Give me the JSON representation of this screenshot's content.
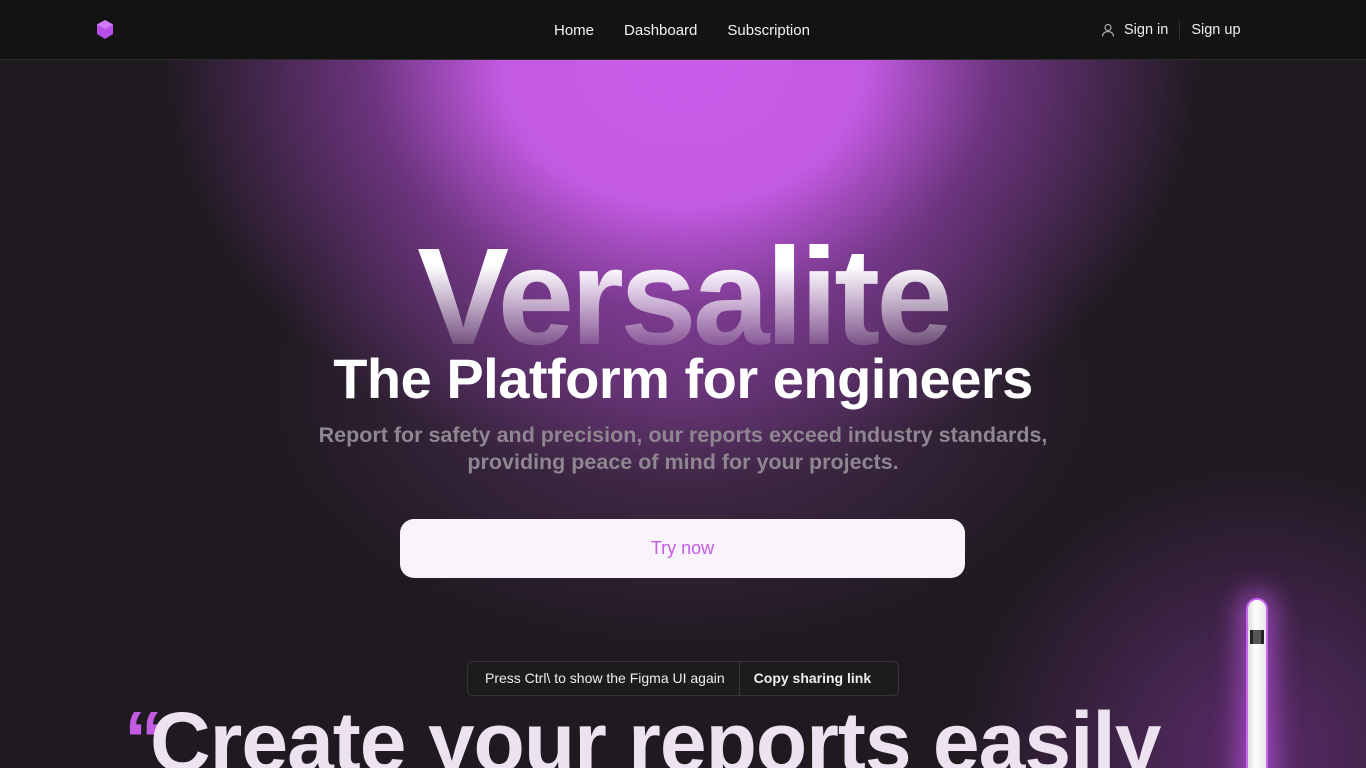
{
  "nav": {
    "links": [
      "Home",
      "Dashboard",
      "Subscription"
    ],
    "sign_in": "Sign in",
    "sign_up": "Sign up"
  },
  "hero": {
    "brand": "Versalite",
    "title": "The Platform for engineers",
    "subtitle_line1": "Report for safety and precision, our reports exceed industry standards,",
    "subtitle_line2": "providing peace of mind for your projects.",
    "cta": "Try now"
  },
  "section": {
    "quote_mark": "“",
    "heading": "Create your reports easily"
  },
  "toast": {
    "message": "Press Ctrl\\ to show the Figma UI again",
    "action": "Copy sharing link"
  },
  "colors": {
    "accent": "#c35ae2",
    "nav_bg": "#131313"
  }
}
